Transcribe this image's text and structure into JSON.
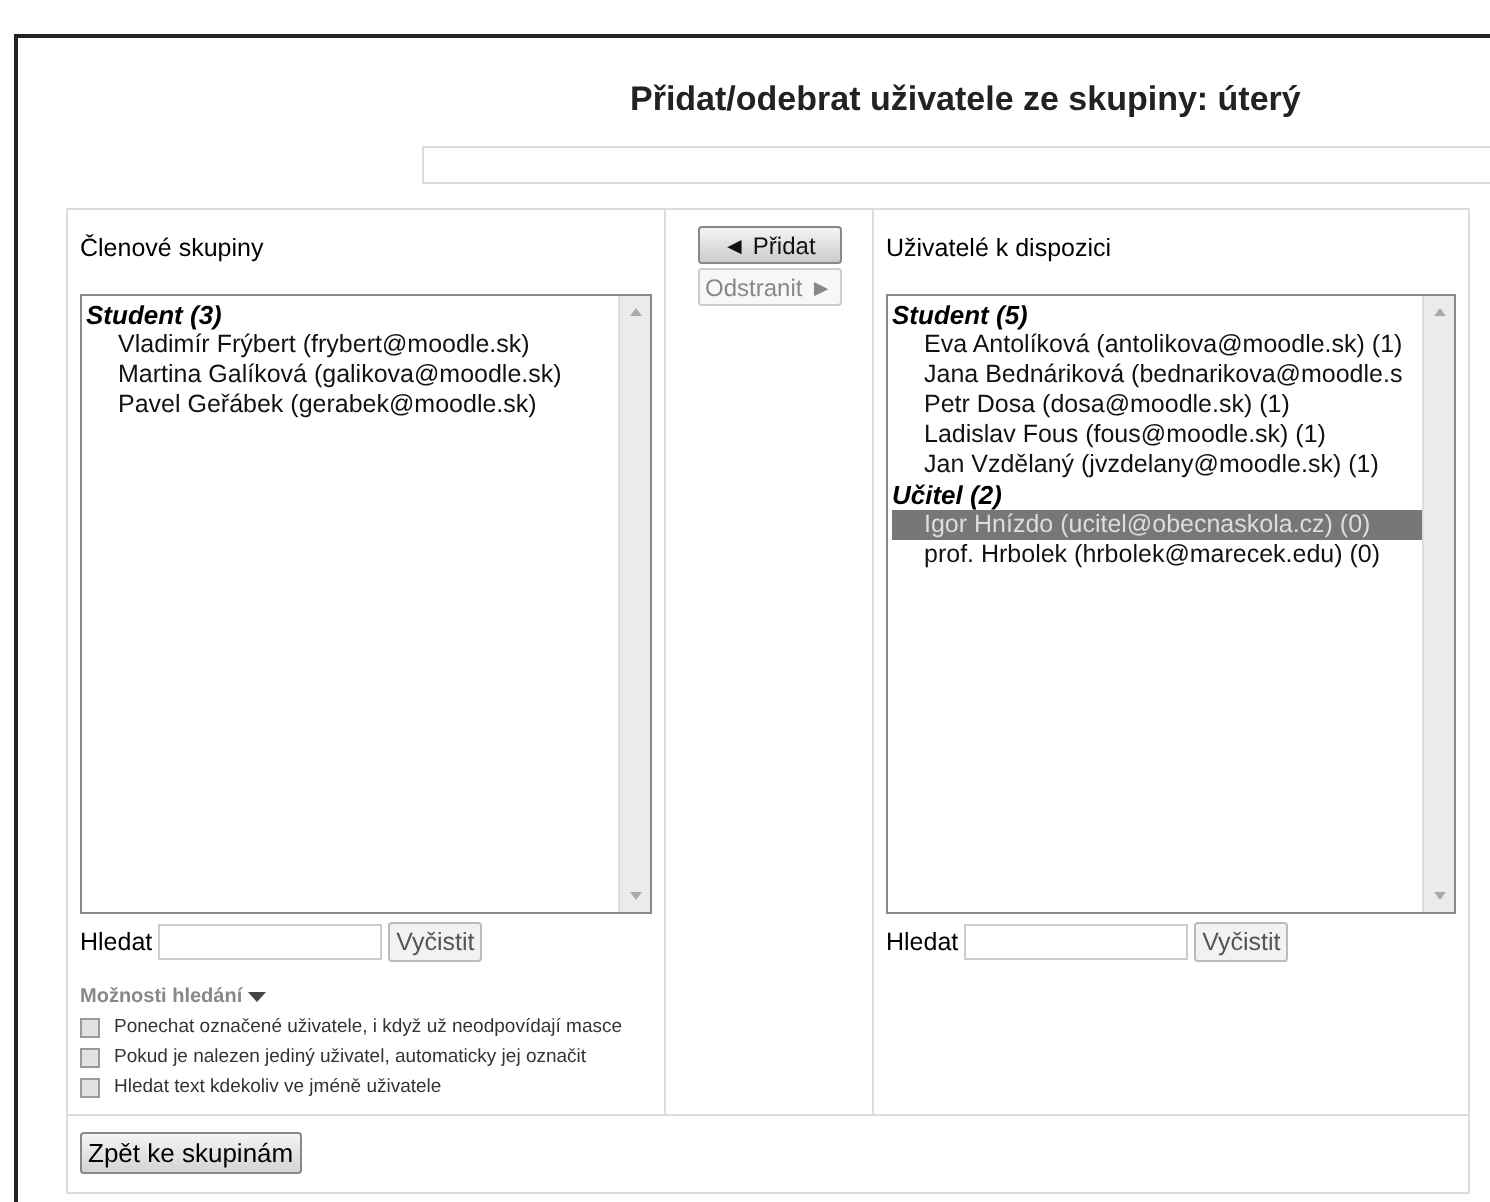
{
  "title": "Přidat/odebrat uživatele ze skupiny: úterý",
  "members": {
    "label": "Členové skupiny",
    "groups": [
      {
        "label": "Student (3)",
        "options": [
          {
            "text": "Vladimír Frýbert (frybert@moodle.sk)",
            "selected": false
          },
          {
            "text": "Martina Galíková (galikova@moodle.sk)",
            "selected": false
          },
          {
            "text": "Pavel Geřábek (gerabek@moodle.sk)",
            "selected": false
          }
        ]
      }
    ],
    "search_label": "Hledat",
    "clear_button": "Vyčistit",
    "options_toggle": "Možnosti hledání",
    "options": [
      {
        "label": "Ponechat označené uživatele, i když už neodpovídají masce",
        "checked": false
      },
      {
        "label": "Pokud je nalezen jediný uživatel, automaticky jej označit",
        "checked": false
      },
      {
        "label": "Hledat text kdekoliv ve jméně uživatele",
        "checked": false
      }
    ]
  },
  "actions": [
    {
      "label": "◄ Přidat",
      "disabled": false
    },
    {
      "label": "Odstranit ►",
      "disabled": true
    }
  ],
  "available": {
    "label": "Uživatelé k dispozici",
    "groups": [
      {
        "label": "Student (5)",
        "options": [
          {
            "text": "Eva Antolíková (antolikova@moodle.sk) (1)",
            "selected": false
          },
          {
            "text": "Jana Bednáriková (bednarikova@moodle.s",
            "selected": false
          },
          {
            "text": "Petr Dosa (dosa@moodle.sk) (1)",
            "selected": false
          },
          {
            "text": "Ladislav Fous (fous@moodle.sk) (1)",
            "selected": false
          },
          {
            "text": "Jan Vzdělaný (jvzdelany@moodle.sk) (1)",
            "selected": false
          }
        ]
      },
      {
        "label": "Učitel (2)",
        "options": [
          {
            "text": "Igor Hnízdo (ucitel@obecnaskola.cz) (0)",
            "selected": true
          },
          {
            "text": "prof. Hrbolek (hrbolek@marecek.edu) (0)",
            "selected": false
          }
        ]
      }
    ],
    "search_label": "Hledat",
    "clear_button": "Vyčistit"
  },
  "back_button": "Zpět ke skupinám"
}
